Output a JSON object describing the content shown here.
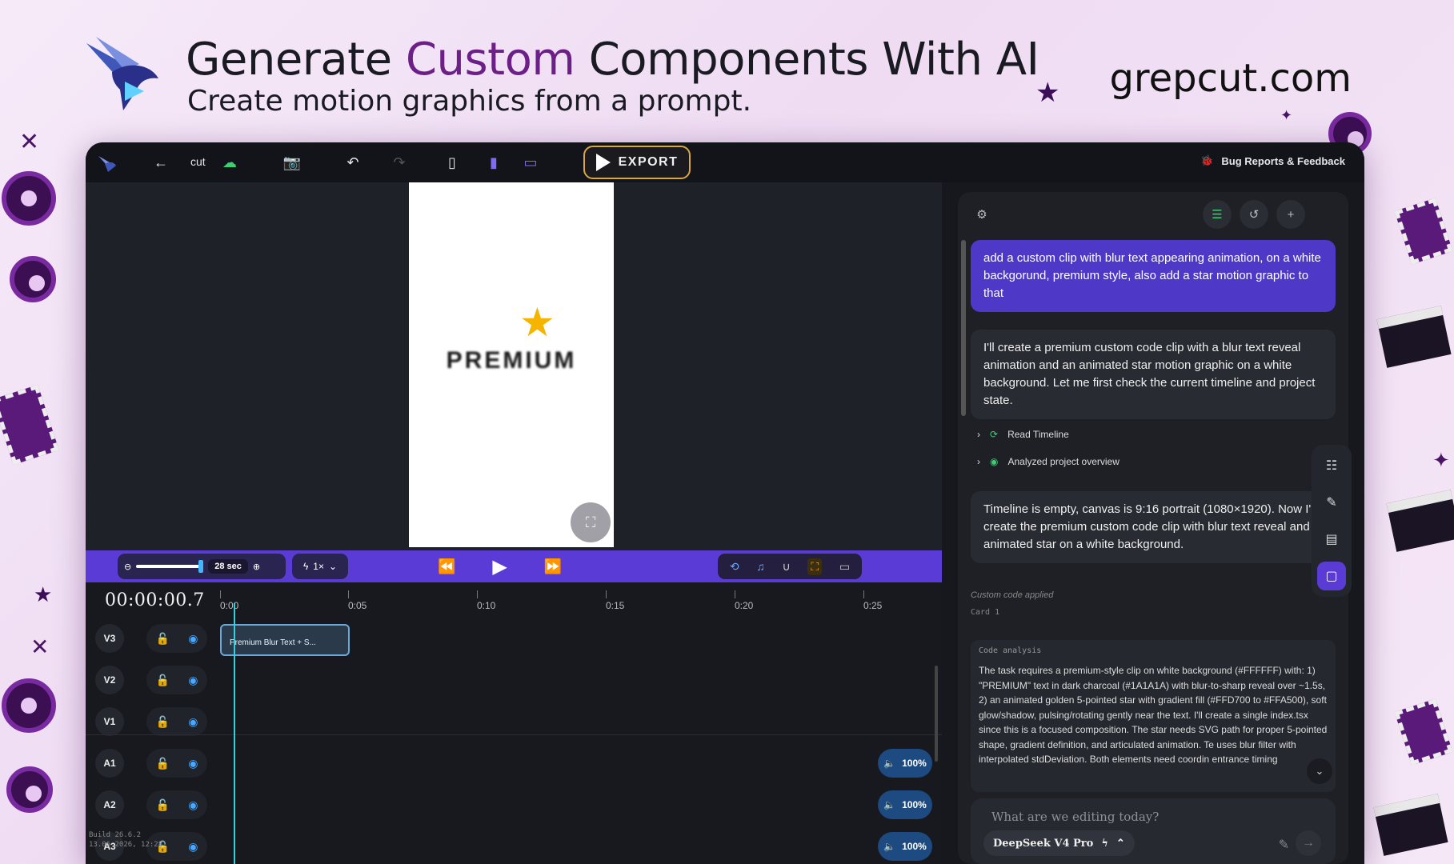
{
  "hero": {
    "headline_pre": "Generate ",
    "headline_accent": "Custom",
    "headline_post": " Components With AI",
    "subline": "Create motion graphics from a prompt.",
    "domain": "grepcut.com",
    "accent_color": "#6b1f87"
  },
  "topbar": {
    "project_name": "cut",
    "export_label": "EXPORT",
    "bug_label": "Bug Reports & Feedback",
    "icons": [
      "logo-icon",
      "back-arrow-icon",
      "cloud-check-icon",
      "camera-icon",
      "undo-icon",
      "redo-icon",
      "layout-left-icon",
      "layout-right-icon",
      "layout-bottom-icon",
      "bug-icon"
    ]
  },
  "canvas": {
    "star": "★",
    "text": "PREMIUM",
    "background": "#FFFFFF"
  },
  "controls": {
    "zoom_value": "28 sec",
    "speed": "1×"
  },
  "timeline": {
    "timecode": "00:00:00.7",
    "ticks": [
      "0:00",
      "0:05",
      "0:10",
      "0:15",
      "0:20",
      "0:25"
    ],
    "tracks": [
      {
        "label": "V3",
        "type": "video"
      },
      {
        "label": "V2",
        "type": "video"
      },
      {
        "label": "V1",
        "type": "video"
      },
      {
        "label": "A1",
        "type": "audio",
        "volume": "100%"
      },
      {
        "label": "A2",
        "type": "audio",
        "volume": "100%"
      },
      {
        "label": "A3",
        "type": "audio",
        "volume": "100%"
      }
    ],
    "clip_label": "Premium Blur Text + S...",
    "build_line1": "Build 26.6.2",
    "build_line2": "13.06.2026, 12:28"
  },
  "chat": {
    "user_message": "add a custom clip with blur text appearing animation, on a white backgorund, premium style, also add a star motion graphic to that",
    "assistant_message_1": "I'll create a premium custom code clip with a blur text reveal animation and an animated star motion graphic on a white background. Let me first check the current timeline and project state.",
    "tool_1": "Read Timeline",
    "tool_2": "Analyzed project overview",
    "assistant_message_2": "Timeline is empty, canvas is 9:16 portrait (1080×1920). Now I'll create the premium custom code clip with blur text reveal and animated star on a white background.",
    "applied": "Custom code applied",
    "card": "Card 1",
    "analysis_header": "Code analysis",
    "analysis_body": "The task requires a premium-style clip on white background (#FFFFFF) with: 1) \"PREMIUM\" text in dark charcoal (#1A1A1A) with blur-to-sharp reveal over ~1.5s, 2) an animated golden 5-pointed star with gradient fill (#FFD700 to #FFA500), soft glow/shadow, pulsing/rotating gently near the text. I'll create a single index.tsx since this is a focused composition. The star needs SVG path for proper 5-pointed shape, gradient definition, and articulated animation. Te uses blur filter with interpolated stdDeviation. Both elements need coordin entrance timing",
    "prompt_placeholder": "What are we editing today?",
    "model_name": "DeepSeek V4 Pro"
  },
  "colors": {
    "app_bg": "#16181d",
    "purple_bar": "#5b3bd6",
    "user_bubble": "#4e38c8",
    "playhead": "#2ed3e0",
    "export_border": "#d9a640"
  }
}
